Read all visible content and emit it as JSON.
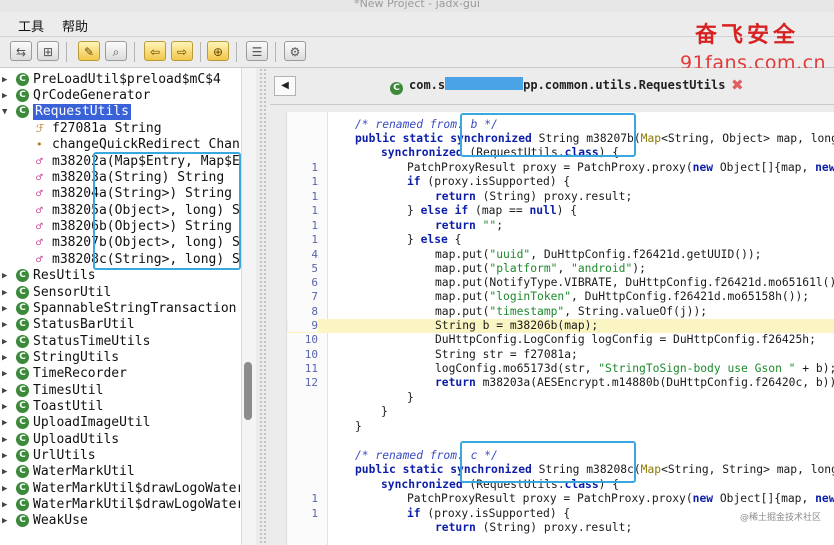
{
  "window": {
    "title": "*New Project - jadx-gui"
  },
  "menu": {
    "tools": "工具",
    "help": "帮助"
  },
  "toolbar": {
    "icons": [
      "sync-icon",
      "flatten-icon",
      "wand-icon",
      "search-icon",
      "back-icon",
      "forward-icon",
      "lock-icon",
      "log-icon",
      "settings-icon"
    ]
  },
  "watermark": {
    "brand_cn": "奋飞安全",
    "brand_url": "91fans.com.cn"
  },
  "tree": {
    "rows": [
      {
        "label": "PreLoadUtil$preload$mC$4"
      },
      {
        "label": "QrCodeGenerator"
      },
      {
        "label": "RequestUtils"
      },
      {
        "label": "f27081a String"
      },
      {
        "label": "changeQuickRedirect Chang"
      },
      {
        "label": "m38202a(Map$Entry, Map$E"
      },
      {
        "label": "m38203a(String) String"
      },
      {
        "label": "m38204a(String>) String"
      },
      {
        "label": "m38205a(Object>, long) S"
      },
      {
        "label": "m38206b(Object>) String"
      },
      {
        "label": "m38207b(Object>, long) S"
      },
      {
        "label": "m38208c(String>, long) S"
      },
      {
        "label": "ResUtils"
      },
      {
        "label": "SensorUtil"
      },
      {
        "label": "SpannableStringTransaction"
      },
      {
        "label": "StatusBarUtil"
      },
      {
        "label": "StatusTimeUtils"
      },
      {
        "label": "StringUtils"
      },
      {
        "label": "TimeRecorder"
      },
      {
        "label": "TimesUtil"
      },
      {
        "label": "ToastUtil"
      },
      {
        "label": "UploadImageUtil"
      },
      {
        "label": "UploadUtils"
      },
      {
        "label": "UrlUtils"
      },
      {
        "label": "WaterMarkUtil"
      },
      {
        "label": "WaterMarkUtil$drawLogoWater"
      },
      {
        "label": "WaterMarkUtil$drawLogoWater"
      },
      {
        "label": "WeakUse"
      }
    ]
  },
  "tab": {
    "prefix": "com.s",
    "suffix": "pp.common.utils.RequestUtils"
  },
  "gutter": [
    "1",
    "1",
    "1",
    "1",
    "1",
    "1",
    "1",
    "4",
    "5",
    "6",
    "7",
    "8",
    "9",
    "10",
    "10",
    "11",
    "12",
    "1",
    "1"
  ],
  "code": {
    "l0": [
      "/* renamed from: b */"
    ],
    "l1": [
      "public static synchronized",
      " String m38207b(",
      "Map",
      "<String, Object> map, long"
    ],
    "l2": [
      "synchronized",
      " (RequestUtils.",
      "class",
      ") {"
    ],
    "l3": [
      "PatchProxyResult proxy = PatchProxy.proxy(",
      "new",
      " Object[]{map, ",
      "new"
    ],
    "l4": [
      "if",
      " (proxy.isSupported) {"
    ],
    "l5": [
      "return",
      " (String) proxy.result;"
    ],
    "l6": [
      "}",
      " else if",
      " (map == ",
      "null",
      ") {"
    ],
    "l7": [
      "return",
      " ",
      "\"\"",
      ";"
    ],
    "l8": [
      "}",
      " else",
      " {"
    ],
    "l9": [
      "map.put(",
      "\"uuid\"",
      ", DuHttpConfig.f26421d.getUUID());"
    ],
    "l10": [
      "map.put(",
      "\"platform\"",
      ", ",
      "\"android\"",
      ");"
    ],
    "l11": [
      "map.put(NotifyType.VIBRATE, DuHttpConfig.f26421d.mo65161l()"
    ],
    "l12": [
      "map.put(",
      "\"loginToken\"",
      ", DuHttpConfig.f26421d.mo65158h());"
    ],
    "l13": [
      "map.put(",
      "\"timestamp\"",
      ", String.valueOf(j));"
    ],
    "l14": [
      "String b = m38206b(map);"
    ],
    "l15": [
      "DuHttpConfig.LogConfig logConfig = DuHttpConfig.f26425h;"
    ],
    "l16": [
      "String str = f27081a;"
    ],
    "l17": [
      "logConfig.mo65173d(str, ",
      "\"StringToSign-body use Gson \"",
      " + b);"
    ],
    "l18": [
      "return",
      " m38203a(AESEncrypt.m14880b(DuHttpConfig.f26420c, b))"
    ],
    "l19": [
      "}"
    ],
    "l20": [
      "}"
    ],
    "l21": [
      "}"
    ],
    "l22": [
      "/* renamed from: c */"
    ],
    "l23": [
      "public static synchronized",
      " String m38208c(",
      "Map",
      "<String, String> map, long"
    ],
    "l24": [
      "synchronized",
      " (RequestUtils.",
      "class",
      ") {"
    ],
    "l25": [
      "PatchProxyResult proxy = PatchProxy.proxy(",
      "new",
      " Object[]{map, ",
      "new"
    ],
    "l26": [
      "if",
      " (proxy.isSupported) {"
    ],
    "l27": [
      "return",
      " (String) proxy.result;"
    ]
  },
  "corner_mark": "@稀土掘金技术社区"
}
